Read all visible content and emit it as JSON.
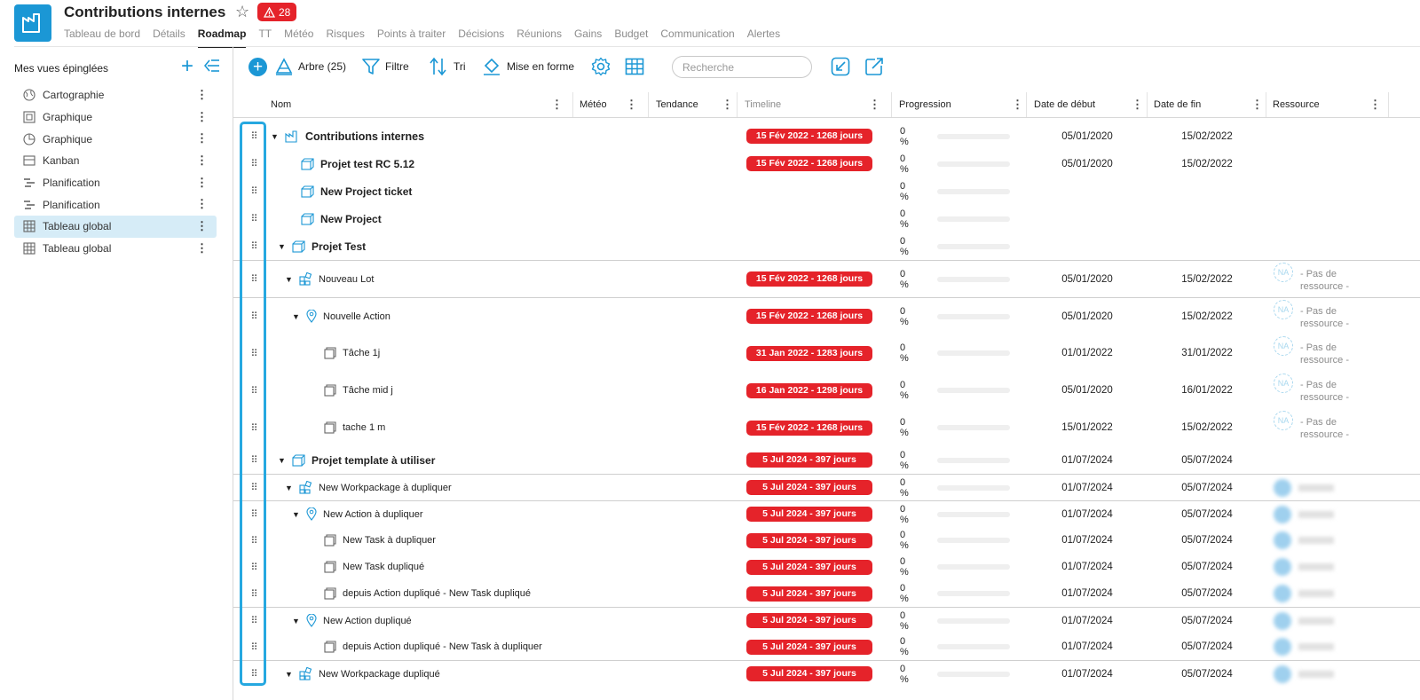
{
  "header": {
    "title": "Contributions internes",
    "alert_count": "28",
    "tabs": [
      "Tableau de bord",
      "Détails",
      "Roadmap",
      "TT",
      "Météo",
      "Risques",
      "Points à traiter",
      "Décisions",
      "Réunions",
      "Gains",
      "Budget",
      "Communication",
      "Alertes"
    ],
    "active_tab": "Roadmap"
  },
  "sidebar": {
    "heading": "Mes vues épinglées",
    "items": [
      {
        "label": "Cartographie",
        "icon": "globe-icon"
      },
      {
        "label": "Graphique",
        "icon": "chart-icon"
      },
      {
        "label": "Graphique",
        "icon": "pie-chart-icon"
      },
      {
        "label": "Kanban",
        "icon": "kanban-icon"
      },
      {
        "label": "Planification",
        "icon": "gantt-icon"
      },
      {
        "label": "Planification",
        "icon": "gantt-icon"
      },
      {
        "label": "Tableau global",
        "icon": "table-icon",
        "selected": true
      },
      {
        "label": "Tableau global",
        "icon": "table-icon"
      }
    ]
  },
  "toolbar": {
    "tree_label": "Arbre (25)",
    "filter_label": "Filtre",
    "sort_label": "Tri",
    "format_label": "Mise en forme",
    "search_placeholder": "Recherche"
  },
  "table": {
    "columns": [
      "Nom",
      "Météo",
      "Tendance",
      "Timeline",
      "Progression",
      "Date de début",
      "Date de fin",
      "Ressource"
    ],
    "rows": [
      {
        "name": "Contributions internes",
        "timeline": "15 Fév 2022 - 1268 jours",
        "progress": "0 %",
        "start": "05/01/2020",
        "end": "15/02/2022",
        "resource": ""
      },
      {
        "name": "Projet test RC 5.12",
        "timeline": "15 Fév 2022 - 1268 jours",
        "progress": "0 %",
        "start": "05/01/2020",
        "end": "15/02/2022",
        "resource": ""
      },
      {
        "name": "New Project ticket",
        "timeline": "",
        "progress": "0 %",
        "start": "",
        "end": "",
        "resource": ""
      },
      {
        "name": "New Project",
        "timeline": "",
        "progress": "0 %",
        "start": "",
        "end": "",
        "resource": ""
      },
      {
        "name": "Projet Test",
        "timeline": "",
        "progress": "0 %",
        "start": "",
        "end": "",
        "resource": ""
      },
      {
        "name": "Nouveau Lot",
        "timeline": "15 Fév 2022 - 1268 jours",
        "progress": "0 %",
        "start": "05/01/2020",
        "end": "15/02/2022",
        "resource": "- Pas de ressource -",
        "na": "NA"
      },
      {
        "name": "Nouvelle Action",
        "timeline": "15 Fév 2022 - 1268 jours",
        "progress": "0 %",
        "start": "05/01/2020",
        "end": "15/02/2022",
        "resource": "- Pas de ressource -",
        "na": "NA"
      },
      {
        "name": "Tâche 1j",
        "timeline": "31 Jan 2022 - 1283 jours",
        "progress": "0 %",
        "start": "01/01/2022",
        "end": "31/01/2022",
        "resource": "- Pas de ressource -",
        "na": "NA"
      },
      {
        "name": "Tâche mid j",
        "timeline": "16 Jan 2022 - 1298 jours",
        "progress": "0 %",
        "start": "05/01/2020",
        "end": "16/01/2022",
        "resource": "- Pas de ressource -",
        "na": "NA"
      },
      {
        "name": "tache 1 m",
        "timeline": "15 Fév 2022 - 1268 jours",
        "progress": "0 %",
        "start": "15/01/2022",
        "end": "15/02/2022",
        "resource": "- Pas de ressource -",
        "na": "NA"
      },
      {
        "name": "Projet template à utiliser",
        "timeline": "5 Jul 2024 - 397 jours",
        "progress": "0 %",
        "start": "01/07/2024",
        "end": "05/07/2024",
        "resource": ""
      },
      {
        "name": "New Workpackage à dupliquer",
        "timeline": "5 Jul 2024 - 397 jours",
        "progress": "0 %",
        "start": "01/07/2024",
        "end": "05/07/2024",
        "resource": ""
      },
      {
        "name": "New Action à dupliquer",
        "timeline": "5 Jul 2024 - 397 jours",
        "progress": "0 %",
        "start": "01/07/2024",
        "end": "05/07/2024",
        "resource": ""
      },
      {
        "name": "New Task à dupliquer",
        "timeline": "5 Jul 2024 - 397 jours",
        "progress": "0 %",
        "start": "01/07/2024",
        "end": "05/07/2024",
        "resource": ""
      },
      {
        "name": "New Task dupliqué",
        "timeline": "5 Jul 2024 - 397 jours",
        "progress": "0 %",
        "start": "01/07/2024",
        "end": "05/07/2024",
        "resource": ""
      },
      {
        "name": "depuis Action dupliqué - New Task dupliqué",
        "timeline": "5 Jul 2024 - 397 jours",
        "progress": "0 %",
        "start": "01/07/2024",
        "end": "05/07/2024",
        "resource": ""
      },
      {
        "name": "New Action dupliqué",
        "timeline": "5 Jul 2024 - 397 jours",
        "progress": "0 %",
        "start": "01/07/2024",
        "end": "05/07/2024",
        "resource": ""
      },
      {
        "name": "depuis Action dupliqué - New Task à dupliquer",
        "timeline": "5 Jul 2024 - 397 jours",
        "progress": "0 %",
        "start": "01/07/2024",
        "end": "05/07/2024",
        "resource": ""
      },
      {
        "name": "New Workpackage dupliqué",
        "timeline": "5 Jul 2024 - 397 jours",
        "progress": "0 %",
        "start": "01/07/2024",
        "end": "05/07/2024",
        "resource": ""
      }
    ]
  },
  "colors": {
    "accent": "#1b97d5",
    "alert": "#e5232a",
    "selected_bg": "#d6ecf7"
  }
}
